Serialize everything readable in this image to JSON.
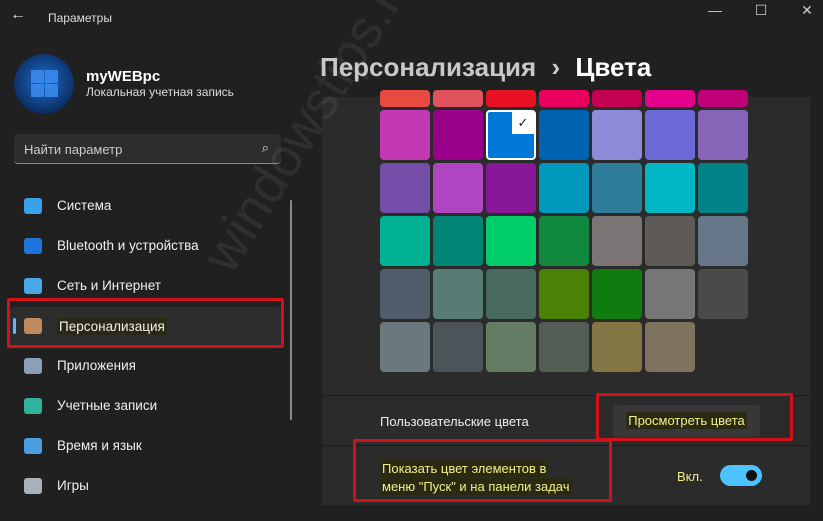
{
  "window": {
    "title": "Параметры",
    "back_icon": "arrow-left",
    "minimize": "—",
    "maximize": "☐",
    "close": "✕"
  },
  "user": {
    "name": "myWEBpc",
    "account_type": "Локальная учетная запись"
  },
  "search": {
    "placeholder": "Найти параметр",
    "icon": "search-icon"
  },
  "sidebar": {
    "items": [
      {
        "label": "Система",
        "icon": "monitor-icon",
        "color": "#3aa0e8"
      },
      {
        "label": "Bluetooth и устройства",
        "icon": "bluetooth-icon",
        "color": "#1e74d8"
      },
      {
        "label": "Сеть и Интернет",
        "icon": "wifi-icon",
        "color": "#4aa8e8"
      },
      {
        "label": "Персонализация",
        "icon": "brush-icon",
        "color": "#c08a60",
        "selected": true
      },
      {
        "label": "Приложения",
        "icon": "apps-icon",
        "color": "#8aa0b8"
      },
      {
        "label": "Учетные записи",
        "icon": "person-icon",
        "color": "#2fb39a"
      },
      {
        "label": "Время и язык",
        "icon": "globe-clock-icon",
        "color": "#4a9ee0"
      },
      {
        "label": "Игры",
        "icon": "gamepad-icon",
        "color": "#a8b0b8"
      }
    ]
  },
  "breadcrumb": {
    "parent": "Персонализация",
    "separator": "›",
    "current": "Цвета"
  },
  "palette": {
    "selected_index": 9,
    "colors": [
      "#e74a40",
      "#e0535d",
      "#e81123",
      "#ea005e",
      "#c30052",
      "#e3008c",
      "#bf0077",
      "#c239b3",
      "#9a0089",
      "#0078d7",
      "#0063b1",
      "#8e8cd8",
      "#6b69d6",
      "#8764b8",
      "#744da9",
      "#b146c2",
      "#881798",
      "#0099bc",
      "#2d7d9a",
      "#00b7c3",
      "#038387",
      "#00b294",
      "#018574",
      "#00cc6a",
      "#10893e",
      "#7a7574",
      "#5d5a58",
      "#68768a",
      "#515c6b",
      "#567c73",
      "#486860",
      "#498205",
      "#107c10",
      "#767676",
      "#4c4a48",
      "#69797e",
      "#4a5459",
      "#647c64",
      "#525e54",
      "#847545",
      "#7e735f"
    ]
  },
  "custom_colors": {
    "label": "Пользовательские цвета",
    "button": "Просмотреть цвета"
  },
  "accent_on_start": {
    "label_line1": "Показать цвет элементов в",
    "label_line2": "меню \"Пуск\" и на панели задач",
    "state": "Вкл.",
    "on": true
  },
  "watermark": "windowstips.ru",
  "accent": "#4cc2ff"
}
